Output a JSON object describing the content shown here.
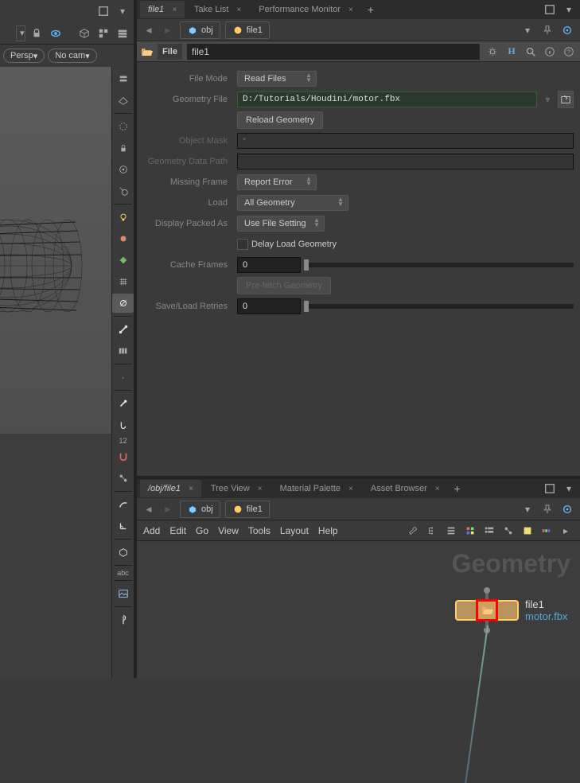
{
  "left": {
    "persp_label": "Persp",
    "nocam_label": "No cam",
    "abc_label": "abc",
    "num_label": "12"
  },
  "parm": {
    "tabs": [
      {
        "label": "file1",
        "active": true,
        "italic": true
      },
      {
        "label": "Take List",
        "active": false
      },
      {
        "label": "Performance Monitor",
        "active": false
      }
    ],
    "path_obj": "obj",
    "path_node": "file1",
    "node_type": "File",
    "node_name": "file1",
    "rows": {
      "file_mode_label": "File Mode",
      "file_mode_value": "Read Files",
      "geometry_file_label": "Geometry File",
      "geometry_file_value": "D:/Tutorials/Houdini/motor.fbx",
      "reload_geometry_label": "Reload Geometry",
      "object_mask_label": "Object Mask",
      "object_mask_value": "*",
      "geometry_data_path_label": "Geometry Data Path",
      "geometry_data_path_value": "",
      "missing_frame_label": "Missing Frame",
      "missing_frame_value": "Report Error",
      "load_label": "Load",
      "load_value": "All Geometry",
      "display_packed_label": "Display Packed As",
      "display_packed_value": "Use File Setting",
      "delay_load_label": "Delay Load Geometry",
      "cache_frames_label": "Cache Frames",
      "cache_frames_value": "0",
      "prefetch_label": "Pre-fetch Geometry",
      "save_retries_label": "Save/Load Retries",
      "save_retries_value": "0"
    }
  },
  "net": {
    "tabs": [
      {
        "label": "/obj/file1",
        "active": true,
        "italic": true
      },
      {
        "label": "Tree View"
      },
      {
        "label": "Material Palette"
      },
      {
        "label": "Asset Browser"
      }
    ],
    "path_obj": "obj",
    "path_node": "file1",
    "menus": [
      "Add",
      "Edit",
      "Go",
      "View",
      "Tools",
      "Layout",
      "Help"
    ],
    "context_label": "Geometry",
    "node_name": "file1",
    "node_file": "motor.fbx"
  }
}
